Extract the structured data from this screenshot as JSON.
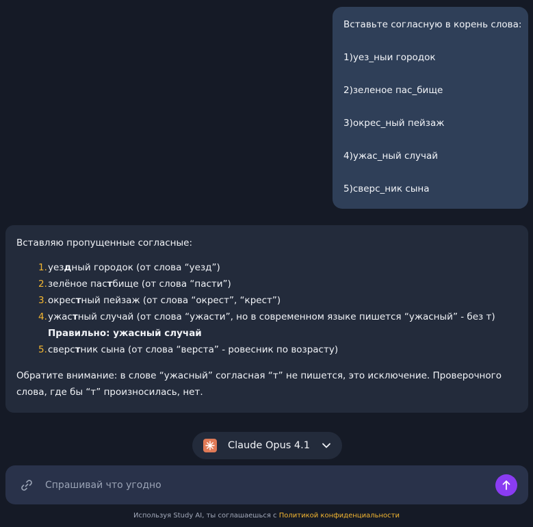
{
  "user_message": {
    "lines": [
      "Вставьте согласную в корень слова:",
      "1)уез_ныи городок",
      "2)зеленое пас_бище",
      "3)окрес_ный пейзаж",
      "4)ужас_ный случай",
      "5)сверс_ник сына"
    ]
  },
  "ai_message": {
    "intro": "Вставляю пропущенные согласные:",
    "items": [
      {
        "num": "1",
        "pre": "уез",
        "bold": "д",
        "post": "ный городок (от слова “уезд”)"
      },
      {
        "num": "2",
        "pre": "зелёное пас",
        "bold": "т",
        "post": "бище (от слова “пасти”)"
      },
      {
        "num": "3",
        "pre": "окрес",
        "bold": "т",
        "post": "ный пейзаж (от слова “окрест”, “крест”)"
      },
      {
        "num": "4",
        "pre": "ужас",
        "bold": "т",
        "post": "ный случай (от слова “ужасти”, но в современном языке пишется “ужасный” - без т)"
      },
      {
        "num": "5",
        "pre": "сверс",
        "bold": "т",
        "post": "ник сына (от слова “верста” - ровесник по возрасту)"
      }
    ],
    "note": "Правильно: ужасный случай",
    "footer": "Обратите внимание: в слове “ужасный” согласная “т” не пишется, это исключение. Проверочного слова, где бы “т” произносилась, нет."
  },
  "model_selector": {
    "label": "Claude Opus 4.1",
    "icon": "claude-logo-icon",
    "accent": "#e07a57"
  },
  "input": {
    "placeholder": "Спрашивай что угодно",
    "value": ""
  },
  "footer": {
    "text": "Используя Study AI, ты соглашаешься с ",
    "link": "Политикой конфиденциальности"
  },
  "colors": {
    "background": "#151a26",
    "user_bubble": "#2f3f58",
    "ai_bubble": "#232b3b",
    "number_accent": "#f5b731",
    "send_button": "#8a3cf2"
  }
}
